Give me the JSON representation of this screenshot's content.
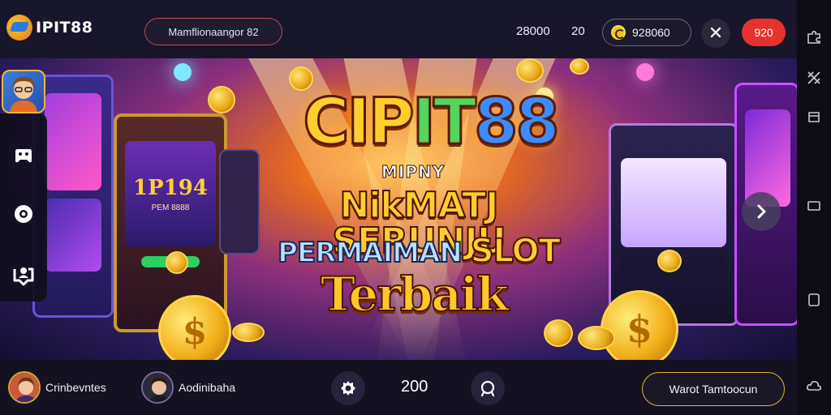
{
  "header": {
    "logo_text": "IPIT88",
    "search_label": "Mamflionaangor 82",
    "stat_a": "28000",
    "stat_b": "20",
    "wallet_balance": "928060",
    "topup_label": "920"
  },
  "banner": {
    "brand_part1": "CIP",
    "brand_part2": "IT",
    "brand_part3": "88",
    "tagline": "MIPNY",
    "headline_line1": "NikMATJ SERUNJU",
    "headline_line2_a": "PERMAIMAN ",
    "headline_line2_b": "SLOT",
    "headline_line3": "Terbaik",
    "left_machine_text": "1P194",
    "left_machine_sub": "PEM 8888",
    "coin_symbol": "$"
  },
  "footer": {
    "player1_name": "Crinbevntes",
    "player2_name": "Aodinibaha",
    "count": "200",
    "cta_label": "Warot Tamtoocun"
  },
  "colors": {
    "accent_red": "#e5322f",
    "gold": "#f2b11a",
    "background": "#14111f"
  },
  "icons": {
    "rail": [
      "puzzle-icon",
      "crossed-tools-icon",
      "bookmark-icon",
      "message-icon",
      "tablet-icon",
      "cloud-icon"
    ],
    "left_rail": [
      "controller-icon",
      "settings-icon",
      "chat-user-icon"
    ],
    "footer": [
      "gear-icon",
      "refresh-icon"
    ]
  }
}
